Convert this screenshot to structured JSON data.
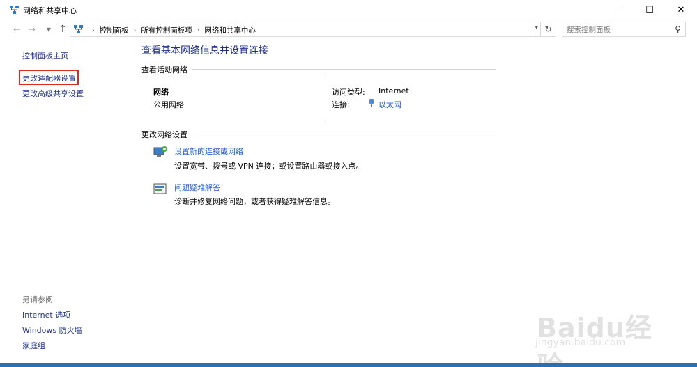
{
  "window": {
    "title": "网络和共享中心",
    "minimize": "—",
    "maximize": "☐",
    "close": "✕"
  },
  "nav": {
    "breadcrumbs": [
      "控制面板",
      "所有控制面板项",
      "网络和共享中心"
    ],
    "search_placeholder": "搜索控制面板"
  },
  "sidebar": {
    "home": "控制面板主页",
    "adapter": "更改适配器设置",
    "advanced": "更改高级共享设置",
    "see_also": "另请参阅",
    "internet_options": "Internet 选项",
    "firewall": "Windows 防火墙",
    "homegroup": "家庭组"
  },
  "main": {
    "title": "查看基本网络信息并设置连接",
    "active_networks_label": "查看活动网络",
    "network_name": "网络",
    "network_category": "公用网络",
    "access_type_label": "访问类型:",
    "access_type_value": "Internet",
    "connection_label": "连接:",
    "connection_value": "以太网",
    "change_settings_label": "更改网络设置",
    "tasks": [
      {
        "link": "设置新的连接或网络",
        "desc": "设置宽带、拨号或 VPN 连接；或设置路由器或接入点。"
      },
      {
        "link": "问题疑难解答",
        "desc": "诊断并修复网络问题，或者获得疑难解答信息。"
      }
    ]
  },
  "watermark": {
    "brand": "Baidu经验",
    "url": "jingyan.baidu.com"
  },
  "colors": {
    "link_dark": "#1e3287",
    "link_blue": "#1e5bd1",
    "highlight_box": "#e0281f",
    "window_border": "#2d6fb3"
  }
}
